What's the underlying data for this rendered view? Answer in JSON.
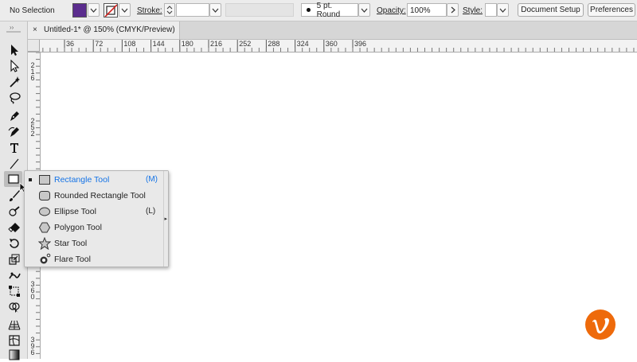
{
  "control_bar": {
    "selection_status": "No Selection",
    "fill_color": "#5b2d8e",
    "stroke_label": "Stroke:",
    "stroke_value": "",
    "brush_value": "5 pt. Round",
    "opacity_label": "Opacity:",
    "opacity_value": "100%",
    "style_label": "Style:",
    "document_setup_label": "Document Setup",
    "preferences_label": "Preferences"
  },
  "document_tab": {
    "close_glyph": "×",
    "title": "Untitled-1* @ 150% (CMYK/Preview)"
  },
  "horizontal_ruler": {
    "labels": [
      "36",
      "72",
      "108",
      "144",
      "180",
      "216",
      "252",
      "288",
      "324",
      "360",
      "396"
    ]
  },
  "vertical_ruler": {
    "labels": [
      "2\n1\n6",
      "2\n5\n2",
      "3\n6\n0",
      "3\n9\n6"
    ]
  },
  "tools": [
    {
      "name": "selection-tool-icon"
    },
    {
      "name": "direct-selection-tool-icon"
    },
    {
      "name": "magic-wand-tool-icon"
    },
    {
      "name": "lasso-tool-icon"
    },
    {
      "name": "pen-tool-icon"
    },
    {
      "name": "curvature-tool-icon"
    },
    {
      "name": "type-tool-icon"
    },
    {
      "name": "line-segment-tool-icon"
    },
    {
      "name": "rectangle-tool-icon"
    },
    {
      "name": "paintbrush-tool-icon"
    },
    {
      "name": "shaper-tool-icon"
    },
    {
      "name": "eraser-tool-icon"
    },
    {
      "name": "rotate-tool-icon"
    },
    {
      "name": "scale-tool-icon"
    },
    {
      "name": "puppet-warp-tool-icon"
    },
    {
      "name": "free-transform-tool-icon"
    },
    {
      "name": "shape-builder-tool-icon"
    },
    {
      "name": "perspective-grid-tool-icon"
    },
    {
      "name": "mesh-tool-icon"
    },
    {
      "name": "gradient-tool-icon"
    }
  ],
  "flyout": {
    "items": [
      {
        "label": "Rectangle Tool",
        "shortcut": "(M)",
        "selected": true,
        "icon": "rectangle-icon"
      },
      {
        "label": "Rounded Rectangle Tool",
        "shortcut": "",
        "selected": false,
        "icon": "rounded-rectangle-icon"
      },
      {
        "label": "Ellipse Tool",
        "shortcut": "(L)",
        "selected": false,
        "icon": "ellipse-icon"
      },
      {
        "label": "Polygon Tool",
        "shortcut": "",
        "selected": false,
        "icon": "polygon-icon"
      },
      {
        "label": "Star Tool",
        "shortcut": "",
        "selected": false,
        "icon": "star-icon"
      },
      {
        "label": "Flare Tool",
        "shortcut": "",
        "selected": false,
        "icon": "flare-icon"
      }
    ]
  },
  "brand": {
    "logo_icon": "vimeo-logo-icon",
    "logo_color": "#ee6a0b",
    "highlight_color": "#1473e6"
  }
}
